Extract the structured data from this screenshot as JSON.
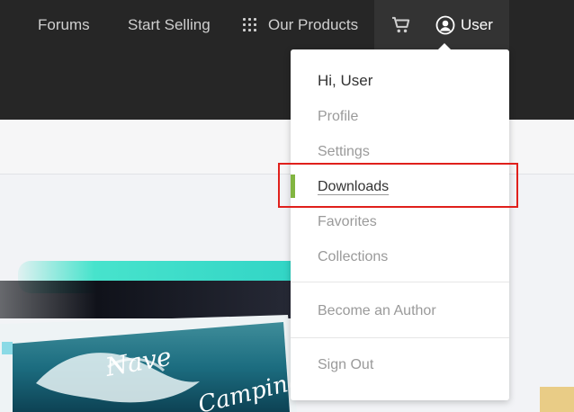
{
  "nav": {
    "forums": "Forums",
    "start_selling": "Start Selling",
    "our_products": "Our Products",
    "user": "User"
  },
  "dropdown": {
    "greeting": "Hi, User",
    "items": [
      "Profile",
      "Settings",
      "Downloads",
      "Favorites",
      "Collections"
    ],
    "active_item": "Downloads",
    "become_author": "Become an Author",
    "sign_out": "Sign Out"
  },
  "colors": {
    "topbar": "#262626",
    "active_indicator": "#82b541",
    "highlight_box": "#e0201c"
  }
}
